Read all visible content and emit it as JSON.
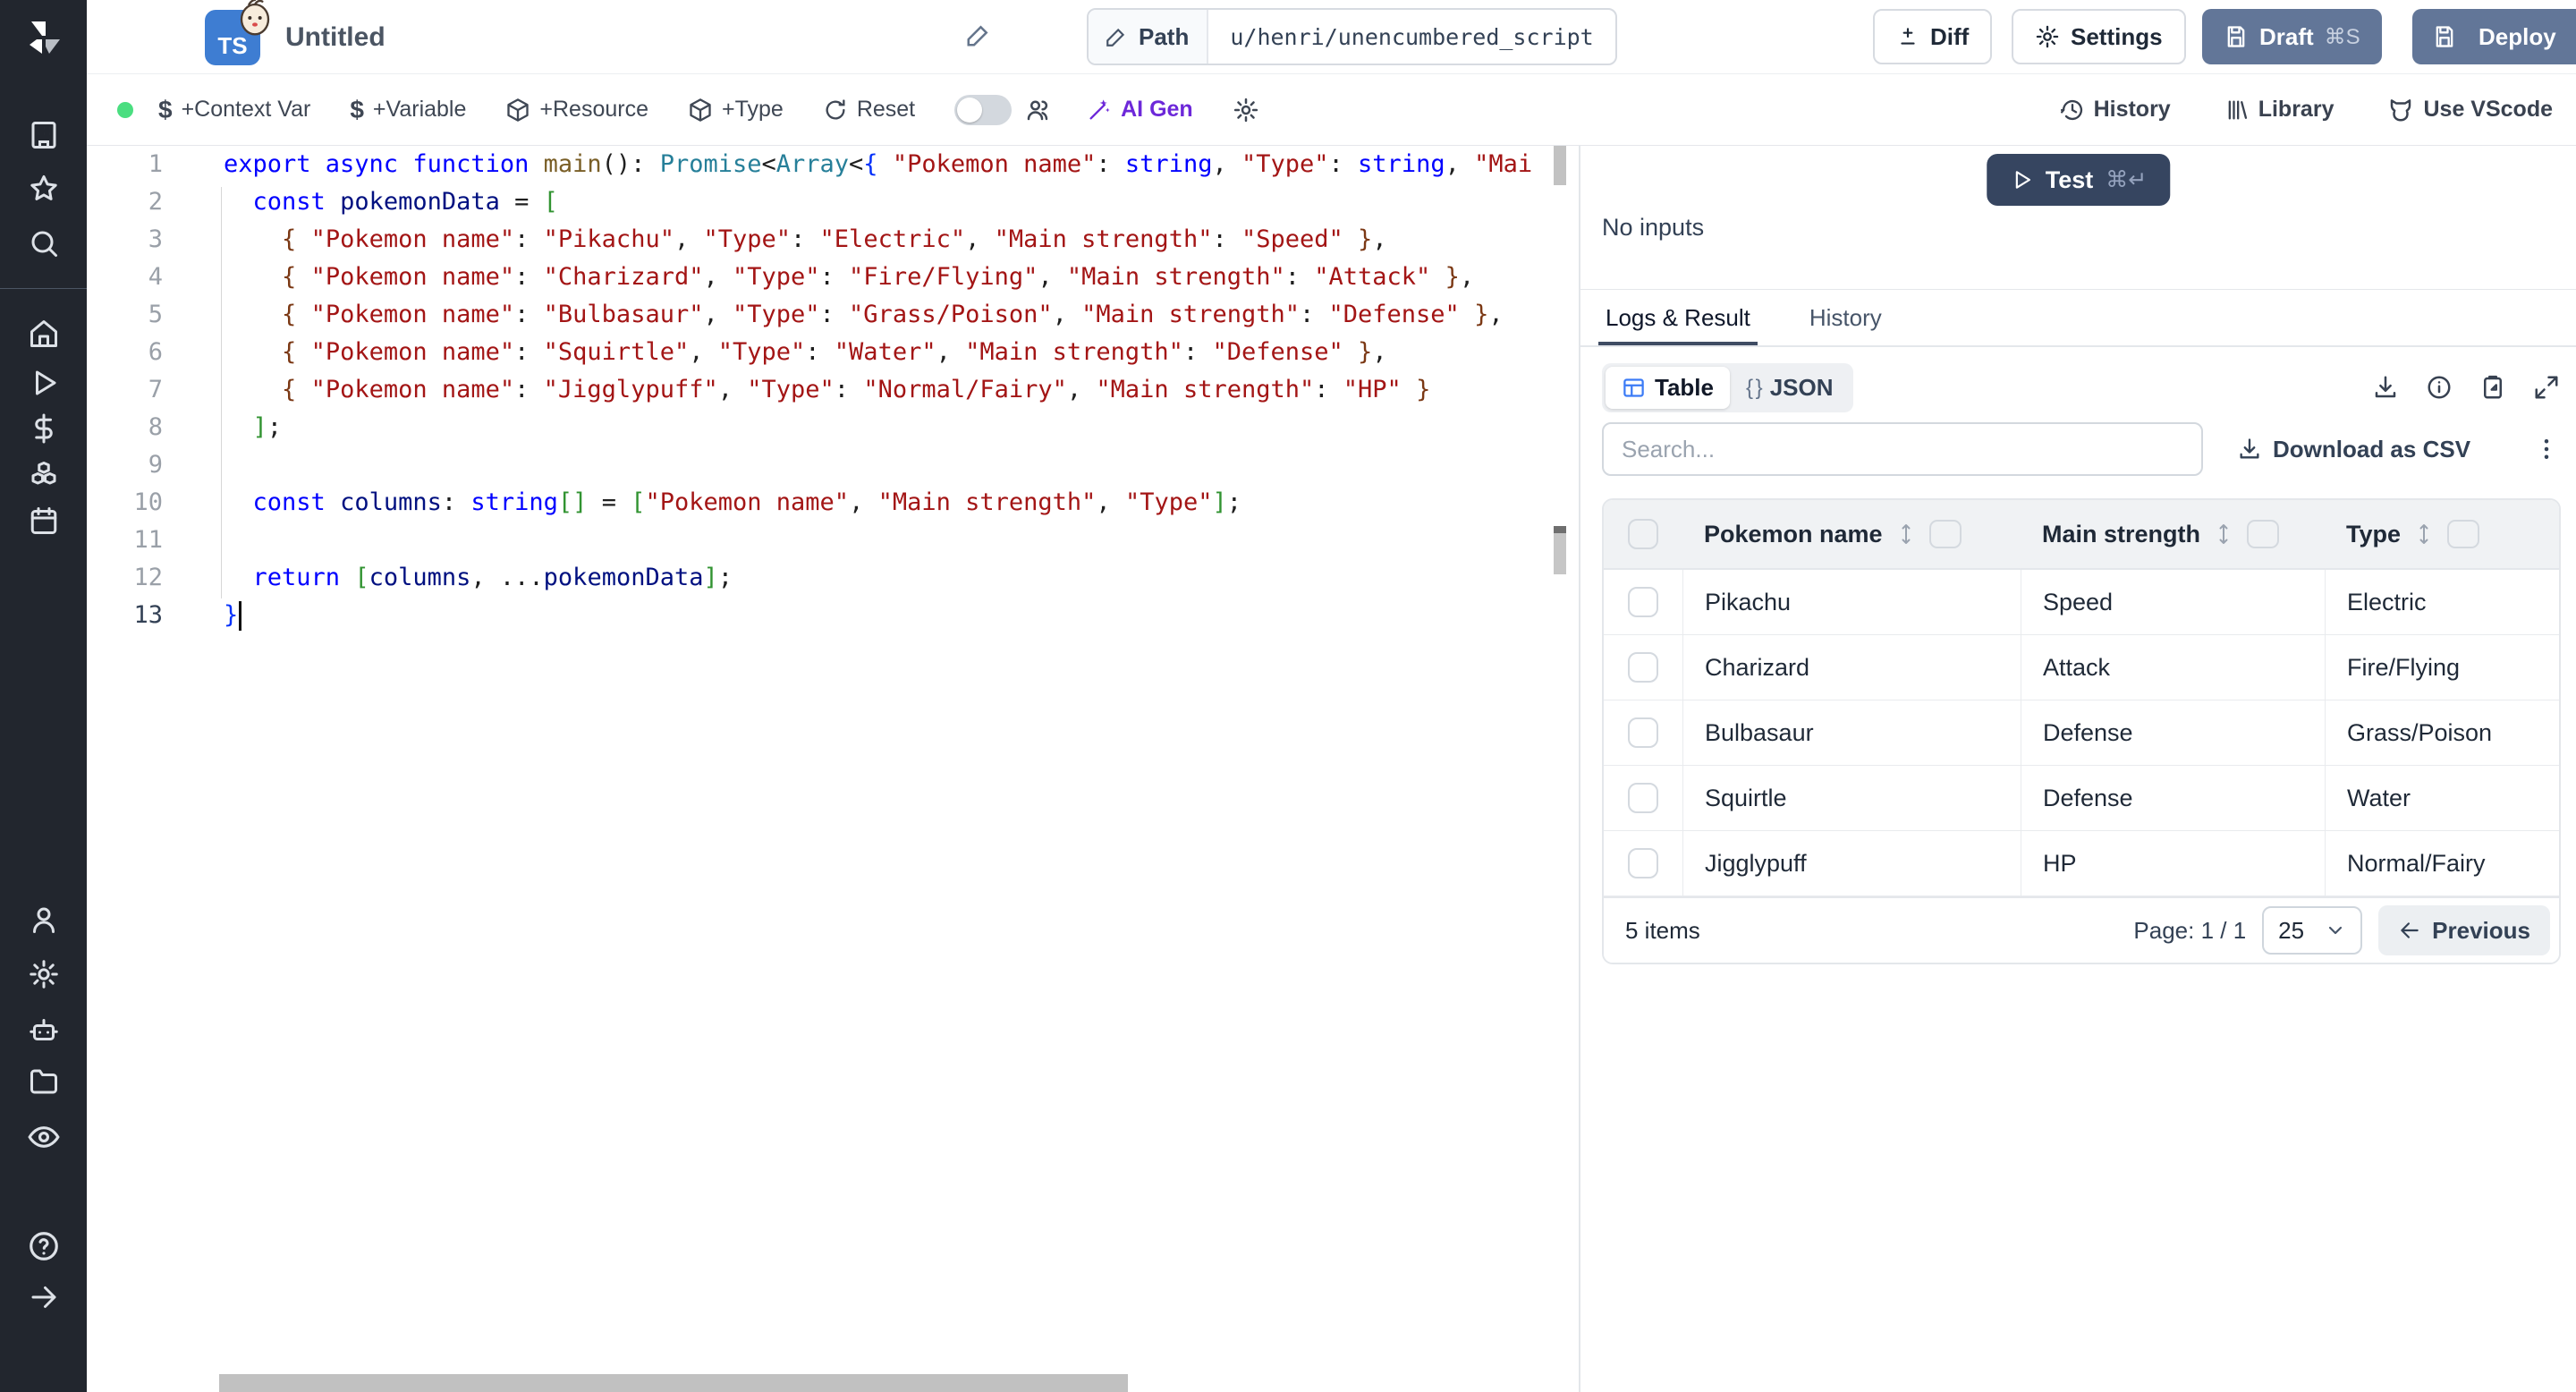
{
  "window": {
    "title": "Untitled"
  },
  "header": {
    "path_label": "Path",
    "path_value": "u/henri/unencumbered_script",
    "diff_label": "Diff",
    "settings_label": "Settings",
    "draft_label": "Draft",
    "draft_shortcut": "⌘S",
    "deploy_label": "Deploy"
  },
  "toolbar": {
    "context_var": "+Context Var",
    "variable": "+Variable",
    "resource": "+Resource",
    "type": "+Type",
    "reset": "Reset",
    "ai_gen": "AI Gen",
    "history": "History",
    "library": "Library",
    "use_vscode": "Use VScode"
  },
  "sidebar": {
    "icons": [
      "windmill-logo",
      "building",
      "star",
      "search",
      "home",
      "play",
      "dollar",
      "boxes",
      "calendar",
      "user",
      "gear",
      "robot",
      "folder",
      "eye",
      "help-circle",
      "arrow-right"
    ]
  },
  "editor": {
    "lines": [
      {
        "num": "1",
        "tokens": [
          [
            "k",
            "export async function "
          ],
          [
            "f",
            "main"
          ],
          [
            "p",
            "(): "
          ],
          [
            "t",
            "Promise"
          ],
          [
            "p",
            "<"
          ],
          [
            "t",
            "Array"
          ],
          [
            "p",
            "<"
          ],
          [
            "b1",
            "{"
          ],
          [
            "p",
            " "
          ],
          [
            "s",
            "\"Pokemon name\""
          ],
          [
            "p",
            ": "
          ],
          [
            "k",
            "string"
          ],
          [
            "p",
            ", "
          ],
          [
            "s",
            "\"Type\""
          ],
          [
            "p",
            ": "
          ],
          [
            "k",
            "string"
          ],
          [
            "p",
            ", "
          ],
          [
            "s",
            "\"Mai"
          ]
        ]
      },
      {
        "num": "2",
        "tokens": [
          [
            "p",
            "  "
          ],
          [
            "k",
            "const"
          ],
          [
            "p",
            " "
          ],
          [
            "v",
            "pokemonData"
          ],
          [
            "p",
            " = "
          ],
          [
            "b2",
            "["
          ]
        ]
      },
      {
        "num": "3",
        "tokens": [
          [
            "p",
            "    "
          ],
          [
            "b3",
            "{"
          ],
          [
            "p",
            " "
          ],
          [
            "s",
            "\"Pokemon name\""
          ],
          [
            "p",
            ": "
          ],
          [
            "s",
            "\"Pikachu\""
          ],
          [
            "p",
            ", "
          ],
          [
            "s",
            "\"Type\""
          ],
          [
            "p",
            ": "
          ],
          [
            "s",
            "\"Electric\""
          ],
          [
            "p",
            ", "
          ],
          [
            "s",
            "\"Main strength\""
          ],
          [
            "p",
            ": "
          ],
          [
            "s",
            "\"Speed\""
          ],
          [
            "p",
            " "
          ],
          [
            "b3",
            "}"
          ],
          [
            "p",
            ","
          ]
        ]
      },
      {
        "num": "4",
        "tokens": [
          [
            "p",
            "    "
          ],
          [
            "b3",
            "{"
          ],
          [
            "p",
            " "
          ],
          [
            "s",
            "\"Pokemon name\""
          ],
          [
            "p",
            ": "
          ],
          [
            "s",
            "\"Charizard\""
          ],
          [
            "p",
            ", "
          ],
          [
            "s",
            "\"Type\""
          ],
          [
            "p",
            ": "
          ],
          [
            "s",
            "\"Fire/Flying\""
          ],
          [
            "p",
            ", "
          ],
          [
            "s",
            "\"Main strength\""
          ],
          [
            "p",
            ": "
          ],
          [
            "s",
            "\"Attack\""
          ],
          [
            "p",
            " "
          ],
          [
            "b3",
            "}"
          ],
          [
            "p",
            ","
          ]
        ]
      },
      {
        "num": "5",
        "tokens": [
          [
            "p",
            "    "
          ],
          [
            "b3",
            "{"
          ],
          [
            "p",
            " "
          ],
          [
            "s",
            "\"Pokemon name\""
          ],
          [
            "p",
            ": "
          ],
          [
            "s",
            "\"Bulbasaur\""
          ],
          [
            "p",
            ", "
          ],
          [
            "s",
            "\"Type\""
          ],
          [
            "p",
            ": "
          ],
          [
            "s",
            "\"Grass/Poison\""
          ],
          [
            "p",
            ", "
          ],
          [
            "s",
            "\"Main strength\""
          ],
          [
            "p",
            ": "
          ],
          [
            "s",
            "\"Defense\""
          ],
          [
            "p",
            " "
          ],
          [
            "b3",
            "}"
          ],
          [
            "p",
            ","
          ]
        ]
      },
      {
        "num": "6",
        "tokens": [
          [
            "p",
            "    "
          ],
          [
            "b3",
            "{"
          ],
          [
            "p",
            " "
          ],
          [
            "s",
            "\"Pokemon name\""
          ],
          [
            "p",
            ": "
          ],
          [
            "s",
            "\"Squirtle\""
          ],
          [
            "p",
            ", "
          ],
          [
            "s",
            "\"Type\""
          ],
          [
            "p",
            ": "
          ],
          [
            "s",
            "\"Water\""
          ],
          [
            "p",
            ", "
          ],
          [
            "s",
            "\"Main strength\""
          ],
          [
            "p",
            ": "
          ],
          [
            "s",
            "\"Defense\""
          ],
          [
            "p",
            " "
          ],
          [
            "b3",
            "}"
          ],
          [
            "p",
            ","
          ]
        ]
      },
      {
        "num": "7",
        "tokens": [
          [
            "p",
            "    "
          ],
          [
            "b3",
            "{"
          ],
          [
            "p",
            " "
          ],
          [
            "s",
            "\"Pokemon name\""
          ],
          [
            "p",
            ": "
          ],
          [
            "s",
            "\"Jigglypuff\""
          ],
          [
            "p",
            ", "
          ],
          [
            "s",
            "\"Type\""
          ],
          [
            "p",
            ": "
          ],
          [
            "s",
            "\"Normal/Fairy\""
          ],
          [
            "p",
            ", "
          ],
          [
            "s",
            "\"Main strength\""
          ],
          [
            "p",
            ": "
          ],
          [
            "s",
            "\"HP\""
          ],
          [
            "p",
            " "
          ],
          [
            "b3",
            "}"
          ]
        ]
      },
      {
        "num": "8",
        "tokens": [
          [
            "p",
            "  "
          ],
          [
            "b2",
            "]"
          ],
          [
            "p",
            ";"
          ]
        ]
      },
      {
        "num": "9",
        "tokens": []
      },
      {
        "num": "10",
        "tokens": [
          [
            "p",
            "  "
          ],
          [
            "k",
            "const"
          ],
          [
            "p",
            " "
          ],
          [
            "v",
            "columns"
          ],
          [
            "p",
            ": "
          ],
          [
            "k",
            "string"
          ],
          [
            "b2",
            "[]"
          ],
          [
            "p",
            " = "
          ],
          [
            "b2",
            "["
          ],
          [
            "s",
            "\"Pokemon name\""
          ],
          [
            "p",
            ", "
          ],
          [
            "s",
            "\"Main strength\""
          ],
          [
            "p",
            ", "
          ],
          [
            "s",
            "\"Type\""
          ],
          [
            "b2",
            "]"
          ],
          [
            "p",
            ";"
          ]
        ]
      },
      {
        "num": "11",
        "tokens": []
      },
      {
        "num": "12",
        "tokens": [
          [
            "p",
            "  "
          ],
          [
            "k",
            "return"
          ],
          [
            "p",
            " "
          ],
          [
            "b2",
            "["
          ],
          [
            "v",
            "columns"
          ],
          [
            "p",
            ", ..."
          ],
          [
            "v",
            "pokemonData"
          ],
          [
            "b2",
            "]"
          ],
          [
            "p",
            ";"
          ]
        ]
      },
      {
        "num": "13",
        "tokens": [
          [
            "b1",
            "}"
          ]
        ]
      }
    ]
  },
  "runner": {
    "test_label": "Test",
    "test_shortcut": "⌘↵",
    "no_inputs": "No inputs",
    "tab_logs": "Logs & Result",
    "tab_history": "History",
    "view_table": "Table",
    "view_json": "JSON",
    "search_placeholder": "Search...",
    "download_csv": "Download as CSV"
  },
  "table": {
    "columns": [
      "Pokemon name",
      "Main strength",
      "Type"
    ],
    "rows": [
      {
        "name": "Pikachu",
        "strength": "Speed",
        "type": "Electric"
      },
      {
        "name": "Charizard",
        "strength": "Attack",
        "type": "Fire/Flying"
      },
      {
        "name": "Bulbasaur",
        "strength": "Defense",
        "type": "Grass/Poison"
      },
      {
        "name": "Squirtle",
        "strength": "Defense",
        "type": "Water"
      },
      {
        "name": "Jigglypuff",
        "strength": "HP",
        "type": "Normal/Fairy"
      }
    ],
    "footer": {
      "items": "5 items",
      "page": "Page: 1 / 1",
      "page_size": "25",
      "previous": "Previous"
    }
  },
  "colors": {
    "accent_button": "#627698",
    "test_button": "#364560",
    "sidebar_bg": "#22262e",
    "ai_gen": "#6d28d9",
    "status_dot": "#4ade80",
    "table_icon_blue": "#3b7bf6"
  }
}
